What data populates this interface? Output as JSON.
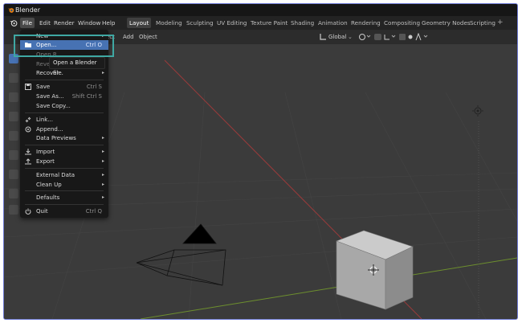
{
  "window": {
    "title": "Blender"
  },
  "menubar": {
    "items": [
      "File",
      "Edit",
      "Render",
      "Window",
      "Help"
    ],
    "workspaces": [
      "Layout",
      "Modeling",
      "Sculpting",
      "UV Editing",
      "Texture Paint",
      "Shading",
      "Animation",
      "Rendering",
      "Compositing",
      "Geometry Nodes",
      "Scripting"
    ],
    "active_workspace": "Layout",
    "plus": "+"
  },
  "header": {
    "view": "ject",
    "add": "Add",
    "object": "Object",
    "orientation": "Global"
  },
  "file_menu": {
    "new": {
      "label": "New",
      "arrow": "▸"
    },
    "open": {
      "label": "Open...",
      "shortcut": "Ctrl O"
    },
    "open_recent": {
      "label": "Open R",
      "arrow": "▸"
    },
    "revert": {
      "label": "Reve"
    },
    "recover": {
      "label": "Recover",
      "arrow": "▸"
    },
    "save": {
      "label": "Save",
      "shortcut": "Ctrl S"
    },
    "save_as": {
      "label": "Save As...",
      "shortcut": "Shift Ctrl S"
    },
    "save_copy": {
      "label": "Save Copy..."
    },
    "link": {
      "label": "Link..."
    },
    "append": {
      "label": "Append..."
    },
    "data_previews": {
      "label": "Data Previews",
      "arrow": "▸"
    },
    "import": {
      "label": "Import",
      "arrow": "▸"
    },
    "export": {
      "label": "Export",
      "arrow": "▸"
    },
    "external_data": {
      "label": "External Data",
      "arrow": "▸"
    },
    "clean_up": {
      "label": "Clean Up",
      "arrow": "▸"
    },
    "defaults": {
      "label": "Defaults",
      "arrow": "▸"
    },
    "quit": {
      "label": "Quit",
      "shortcut": "Ctrl Q"
    }
  },
  "tooltip": {
    "text": "Open a Blender file."
  },
  "colors": {
    "accent": "#4772b3",
    "highlight_box": "#3fa8a3",
    "x_axis": "#9b3b3b",
    "y_axis": "#6d8f2e"
  },
  "icons": [
    "blender-logo-icon",
    "folder-icon",
    "save-icon",
    "link-icon",
    "append-icon",
    "import-icon",
    "export-icon",
    "power-icon",
    "camera-icon",
    "cube-icon",
    "light-icon"
  ]
}
